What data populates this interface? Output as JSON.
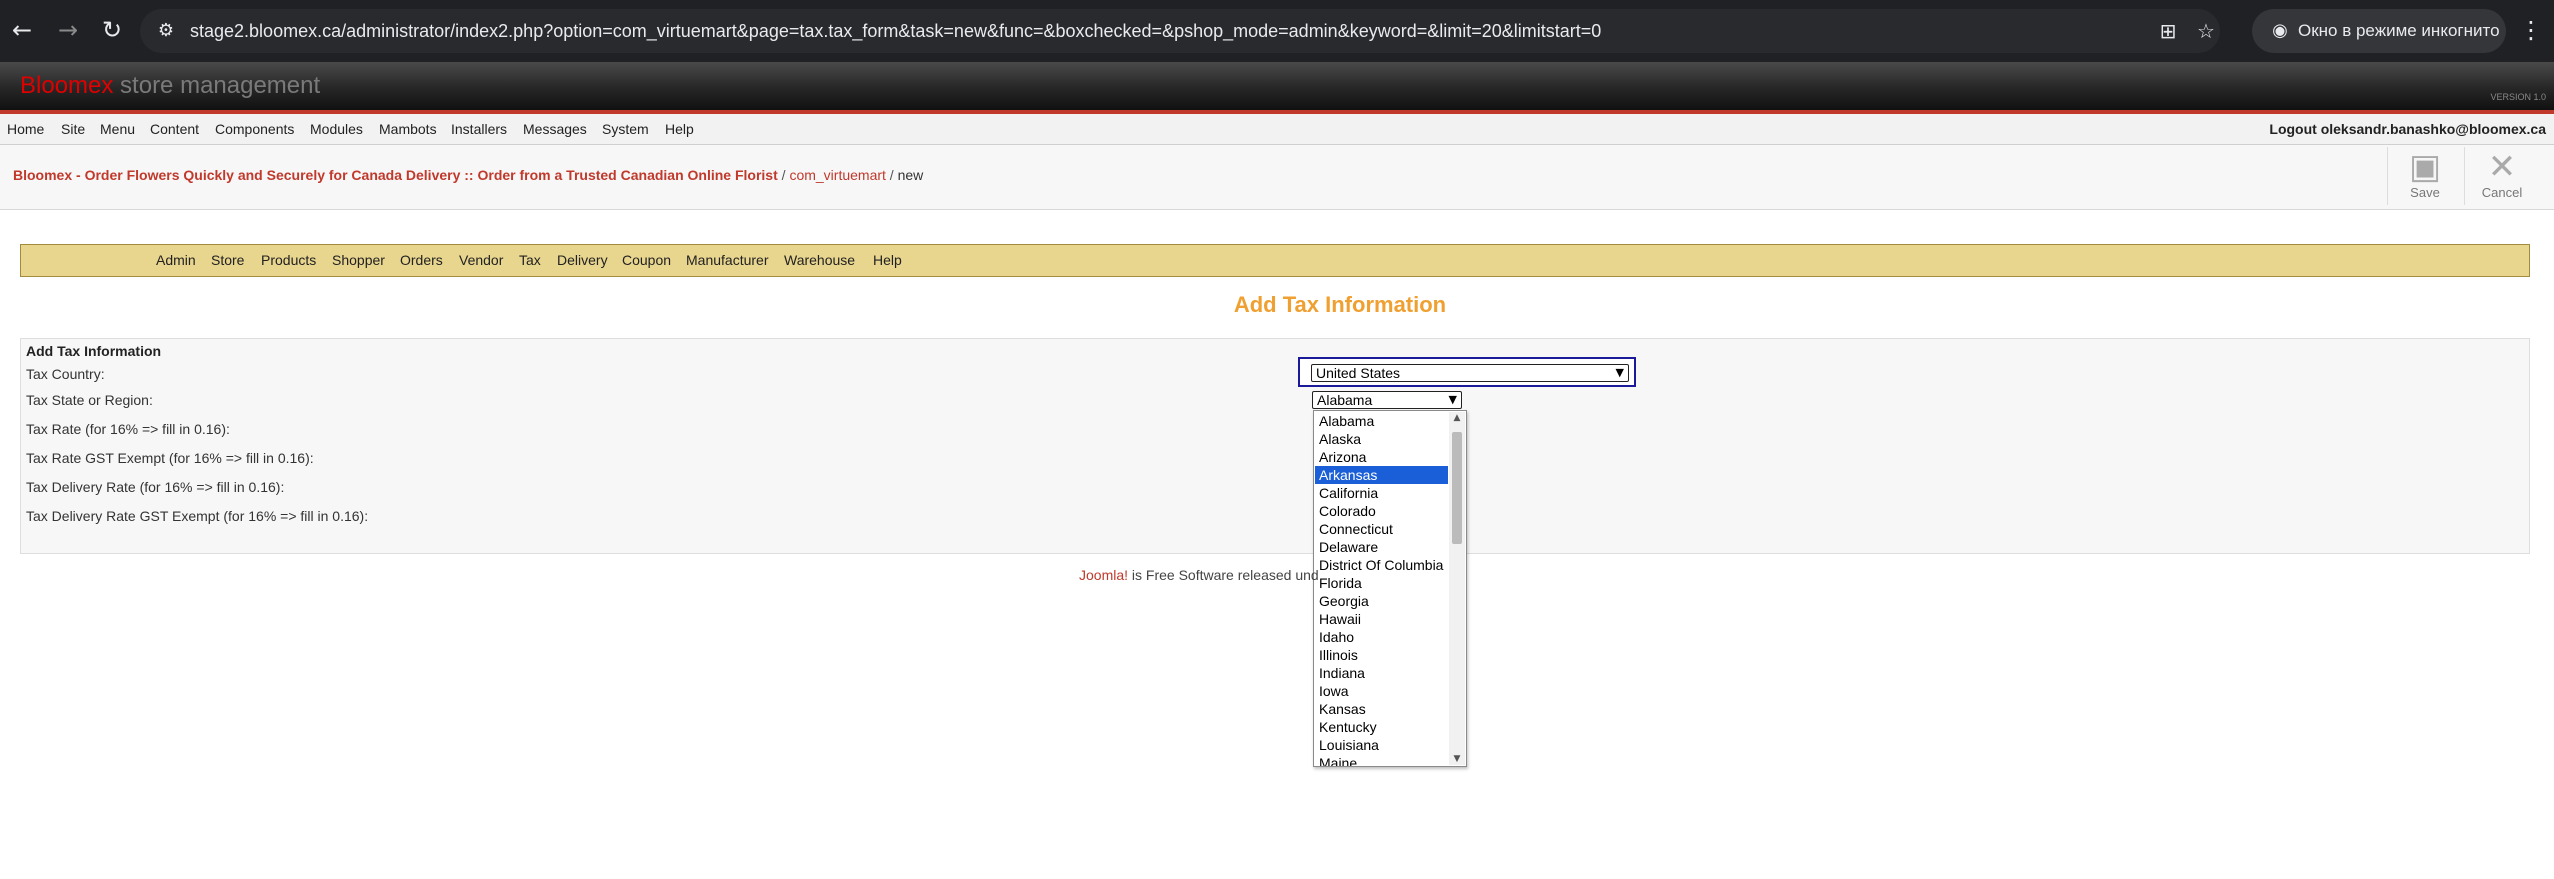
{
  "browser": {
    "url": "stage2.bloomex.ca/administrator/index2.php?option=com_virtuemart&page=tax.tax_form&task=new&func=&boxchecked=&pshop_mode=admin&keyword=&limit=20&limitstart=0",
    "incognito_label": "Окно в режиме инкогнито",
    "icons": [
      "back-icon",
      "forward-icon",
      "reload-icon",
      "site-info-icon",
      "translate-icon",
      "star-icon",
      "incognito-icon",
      "kebab-menu-icon"
    ]
  },
  "header": {
    "brand_primary": "Bloomex",
    "brand_secondary": "store management",
    "version": "VERSION 1.0"
  },
  "main_menu": {
    "items": [
      "Home",
      "Site",
      "Menu",
      "Content",
      "Components",
      "Modules",
      "Mambots",
      "Installers",
      "Messages",
      "System",
      "Help"
    ],
    "logout": "Logout oleksandr.banashko@bloomex.ca"
  },
  "breadcrumb": {
    "site": "Bloomex - Order Flowers Quickly and Securely for Canada Delivery :: Order from a Trusted Canadian Online Florist",
    "separator": "/",
    "component": "com_virtuemart",
    "current": "new"
  },
  "toolbar": {
    "save_label": "Save",
    "cancel_label": "Cancel"
  },
  "vm_menu": {
    "items": [
      "Admin",
      "Store",
      "Products",
      "Shopper",
      "Orders",
      "Vendor",
      "Tax",
      "Delivery",
      "Coupon",
      "Manufacturer",
      "Warehouse",
      "Help"
    ]
  },
  "page_title": "Add Tax Information",
  "form": {
    "legend": "Add Tax Information",
    "labels": {
      "country": "Tax Country:",
      "state": "Tax State or Region:",
      "rate": "Tax Rate (for 16% => fill in 0.16):",
      "rate_gst": "Tax Rate GST Exempt (for 16% => fill in 0.16):",
      "delivery_rate": "Tax Delivery Rate (for 16% => fill in 0.16):",
      "delivery_rate_gst": "Tax Delivery Rate GST Exempt (for 16% => fill in 0.16):"
    },
    "country_value": "United States",
    "state_value": "Alabama",
    "state_options": [
      "Alabama",
      "Alaska",
      "Arizona",
      "Arkansas",
      "California",
      "Colorado",
      "Connecticut",
      "Delaware",
      "District Of Columbia",
      "Florida",
      "Georgia",
      "Hawaii",
      "Idaho",
      "Illinois",
      "Indiana",
      "Iowa",
      "Kansas",
      "Kentucky",
      "Louisiana",
      "Maine"
    ],
    "highlighted_option": "Arkansas"
  },
  "footer": {
    "link": "Joomla!",
    "text": " is Free Software released und"
  },
  "colors": {
    "accent": "#f0a030",
    "brand_red": "#c0392b",
    "submenu_bg": "#e8d58e",
    "selection": "#1a5fd8"
  }
}
